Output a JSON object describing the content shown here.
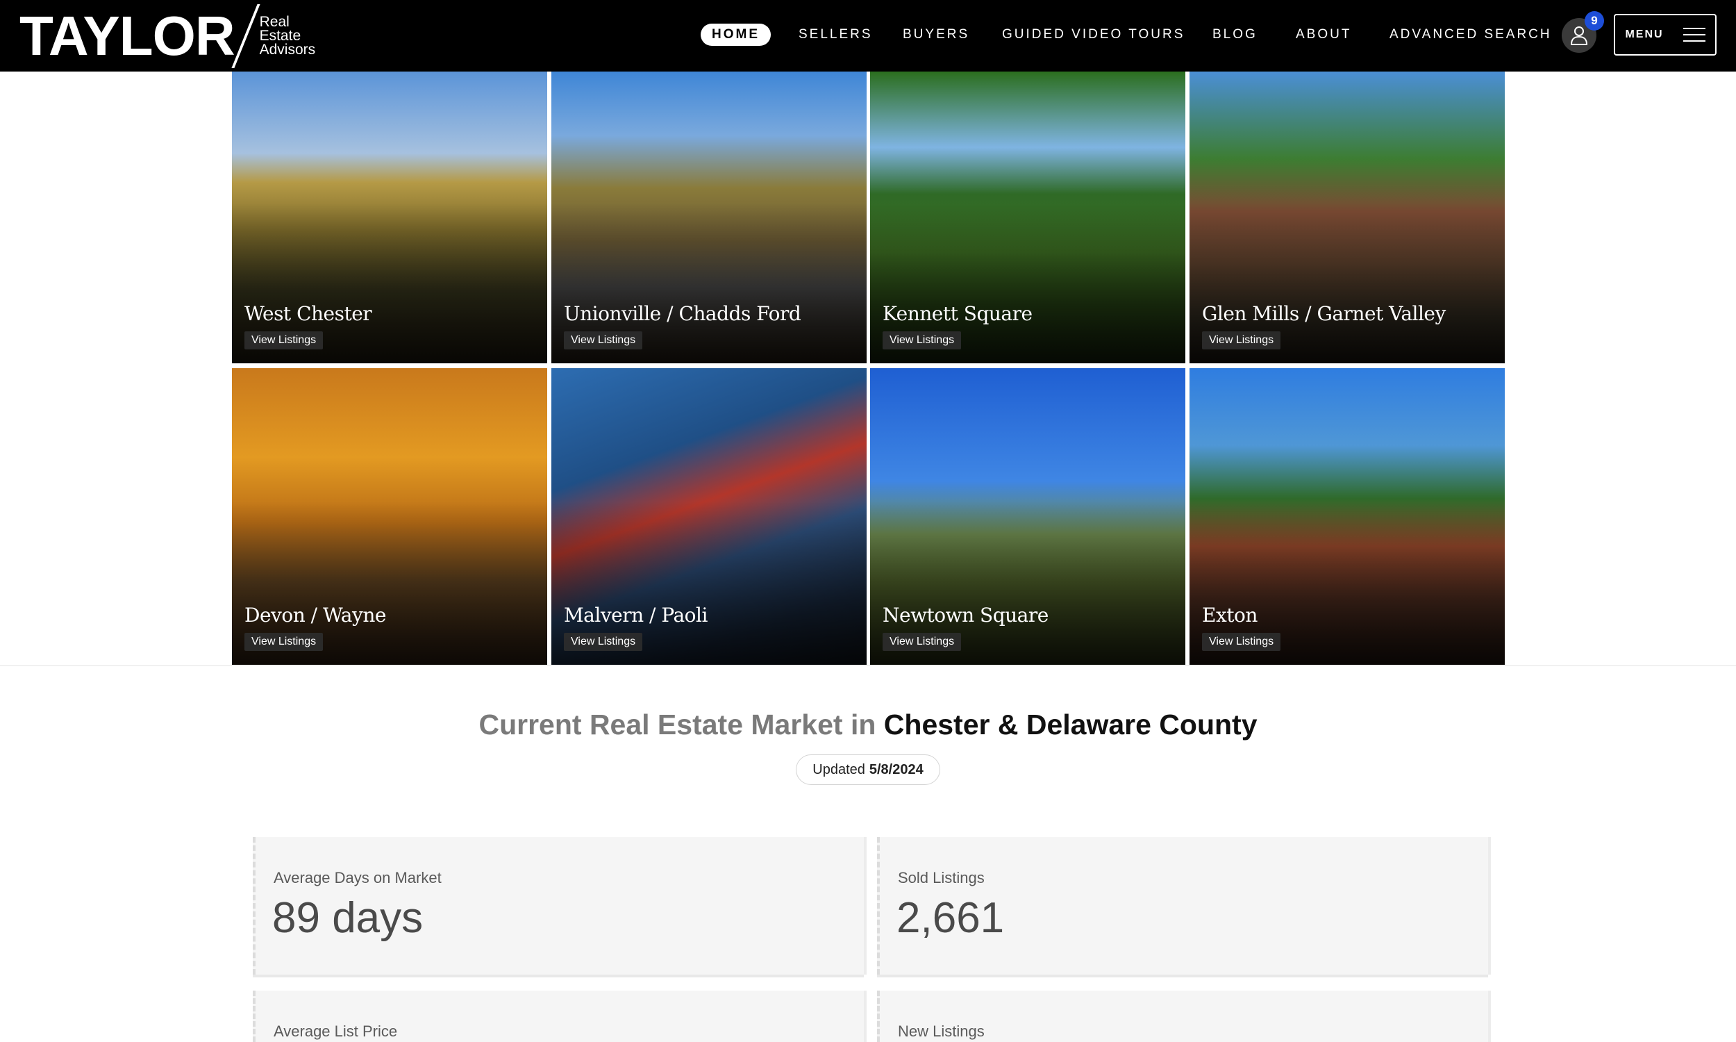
{
  "brand": {
    "name": "TAYLOR",
    "tagline_lines": [
      "Real",
      "Estate",
      "Advisors"
    ]
  },
  "nav": {
    "items": [
      "HOME",
      "SELLERS",
      "BUYERS",
      "GUIDED VIDEO TOURS",
      "BLOG",
      "ABOUT",
      "ADVANCED SEARCH"
    ],
    "active": "HOME",
    "notification_count": "9",
    "menu_label": "MENU"
  },
  "areas": [
    {
      "name": "West Chester",
      "cta": "View Listings"
    },
    {
      "name": "Unionville / Chadds Ford",
      "cta": "View Listings"
    },
    {
      "name": "Kennett Square",
      "cta": "View Listings"
    },
    {
      "name": "Glen Mills / Garnet Valley",
      "cta": "View Listings"
    },
    {
      "name": "Devon / Wayne",
      "cta": "View Listings"
    },
    {
      "name": "Malvern / Paoli",
      "cta": "View Listings"
    },
    {
      "name": "Newtown Square",
      "cta": "View Listings"
    },
    {
      "name": "Exton",
      "cta": "View Listings"
    }
  ],
  "market": {
    "title_prefix": "Current Real Estate Market in",
    "title_location": "Chester & Delaware County",
    "updated_label": "Updated",
    "updated_date": "5/8/2024",
    "stats": [
      {
        "label": "Average Days on Market",
        "value": "89 days"
      },
      {
        "label": "Sold Listings",
        "value": "2,661"
      },
      {
        "label": "Average List Price",
        "value": ""
      },
      {
        "label": "New Listings",
        "value": ""
      }
    ]
  },
  "colors": {
    "header_bg": "#000000",
    "badge": "#1d4ed8",
    "card_bg": "#f5f5f5"
  }
}
